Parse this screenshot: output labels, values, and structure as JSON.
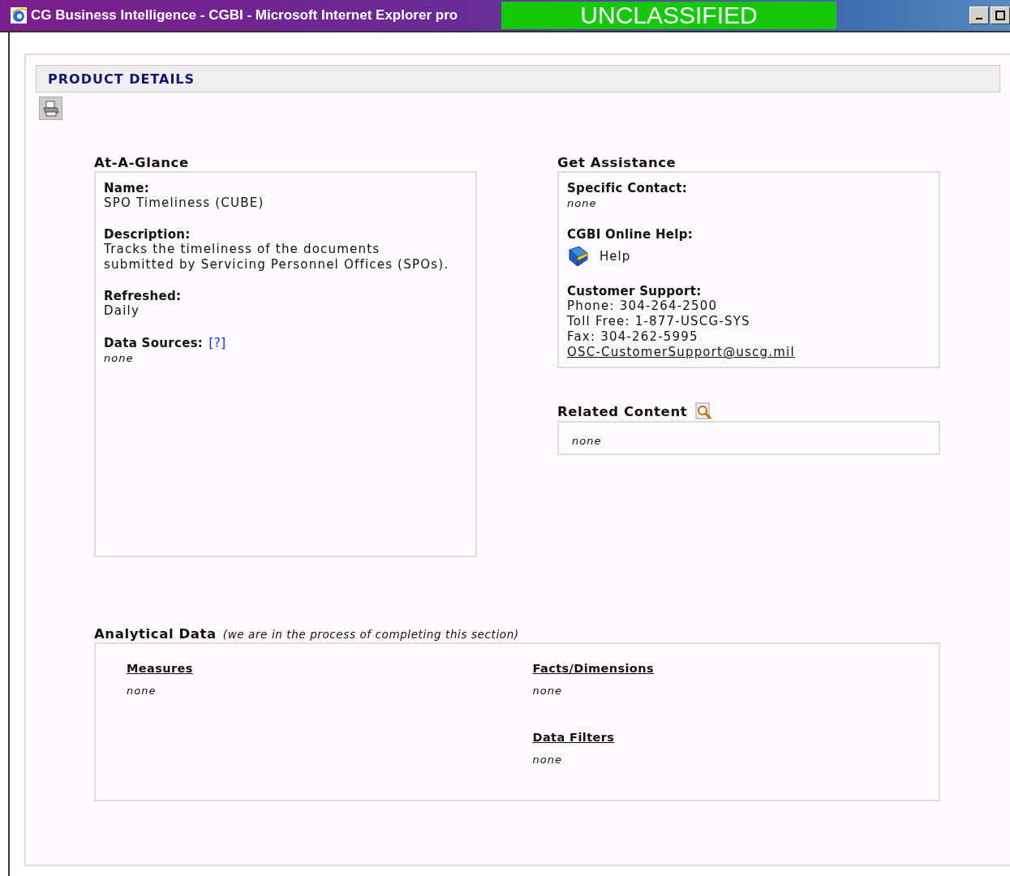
{
  "window": {
    "title": "CG Business Intelligence - CGBI - Microsoft Internet Explorer pro",
    "banner": "UNCLASSIFIED"
  },
  "header": {
    "title": "PRODUCT DETAILS"
  },
  "at_a_glance": {
    "title": "At-A-Glance",
    "fields": [
      {
        "kind": "text",
        "label": "Name:",
        "lines": [
          "SPO Timeliness (CUBE)"
        ]
      },
      {
        "kind": "text",
        "label": "Description:",
        "lines": [
          "Tracks the timeliness of the documents",
          "submitted by Servicing Personnel Offices (SPOs)."
        ]
      },
      {
        "kind": "text",
        "label": "Refreshed:",
        "lines": [
          "Daily"
        ]
      },
      {
        "kind": "empty",
        "label": "Data Sources:",
        "link": "[?]",
        "lines": [
          "none"
        ]
      }
    ]
  },
  "get_assistance": {
    "title": "Get Assistance",
    "fields": [
      {
        "kind": "empty",
        "label": "Specific Contact:",
        "lines": [
          "none"
        ]
      },
      {
        "kind": "help",
        "label": "CGBI Online Help:",
        "link": "Help"
      },
      {
        "kind": "text",
        "label": "Customer Support:",
        "lines": [
          "Phone: 304-264-2500",
          "Toll Free: 1-877-USCG-SYS",
          "Fax: 304-262-5995"
        ],
        "email": "OSC-CustomerSupport@uscg.mil"
      }
    ]
  },
  "related_content": {
    "title": "Related Content",
    "value": "none"
  },
  "analytical_data": {
    "title": "Analytical Data",
    "note": "(we are in the process of completing this section)",
    "columns": [
      [
        {
          "heading": "Measures",
          "value": "none"
        }
      ],
      [
        {
          "heading": "Facts/Dimensions",
          "value": "none"
        },
        {
          "heading": "Data Filters",
          "value": "none"
        }
      ]
    ]
  }
}
